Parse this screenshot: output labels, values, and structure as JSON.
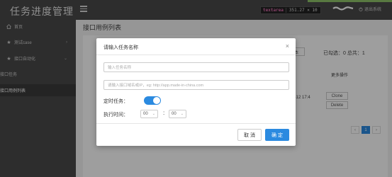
{
  "header": {
    "title": "任务进度管理",
    "logout_label": "退出系统",
    "devtools": {
      "tag": "textarea",
      "size": "351.27 × 10"
    }
  },
  "sidebar": {
    "items": [
      {
        "label": "首页"
      },
      {
        "label": "测试case",
        "chevron": "›"
      },
      {
        "label": "接口自动化",
        "chevron": "⌄"
      },
      {
        "label": "接口任务"
      },
      {
        "label": "接口用例列表"
      }
    ]
  },
  "main": {
    "page_title": "接口用例列表",
    "toolbar_button": "部本",
    "selection_text": "已勾选：0 总共：1",
    "col_time": "间",
    "col_ops": "更多操作",
    "row_time": "12-12 17:4",
    "row_clone": "Clone",
    "row_delete": "Delete",
    "pager_current": "1"
  },
  "modal": {
    "title": "请输入任务名称",
    "close_icon": "×",
    "name_placeholder": "输入任务名称",
    "url_placeholder": "请输入接口域名或IP，eg: http://app.made-in-china.com",
    "timer_label": "定时任务：",
    "timer_on": true,
    "exec_label": "执行时间：",
    "hour_value": "00",
    "minute_value": "00",
    "separator": ":",
    "cancel_label": "取 消",
    "ok_label": "确 定"
  },
  "colors": {
    "accent": "#2b8ae0",
    "sidebar_bg": "#4a4a4a"
  }
}
